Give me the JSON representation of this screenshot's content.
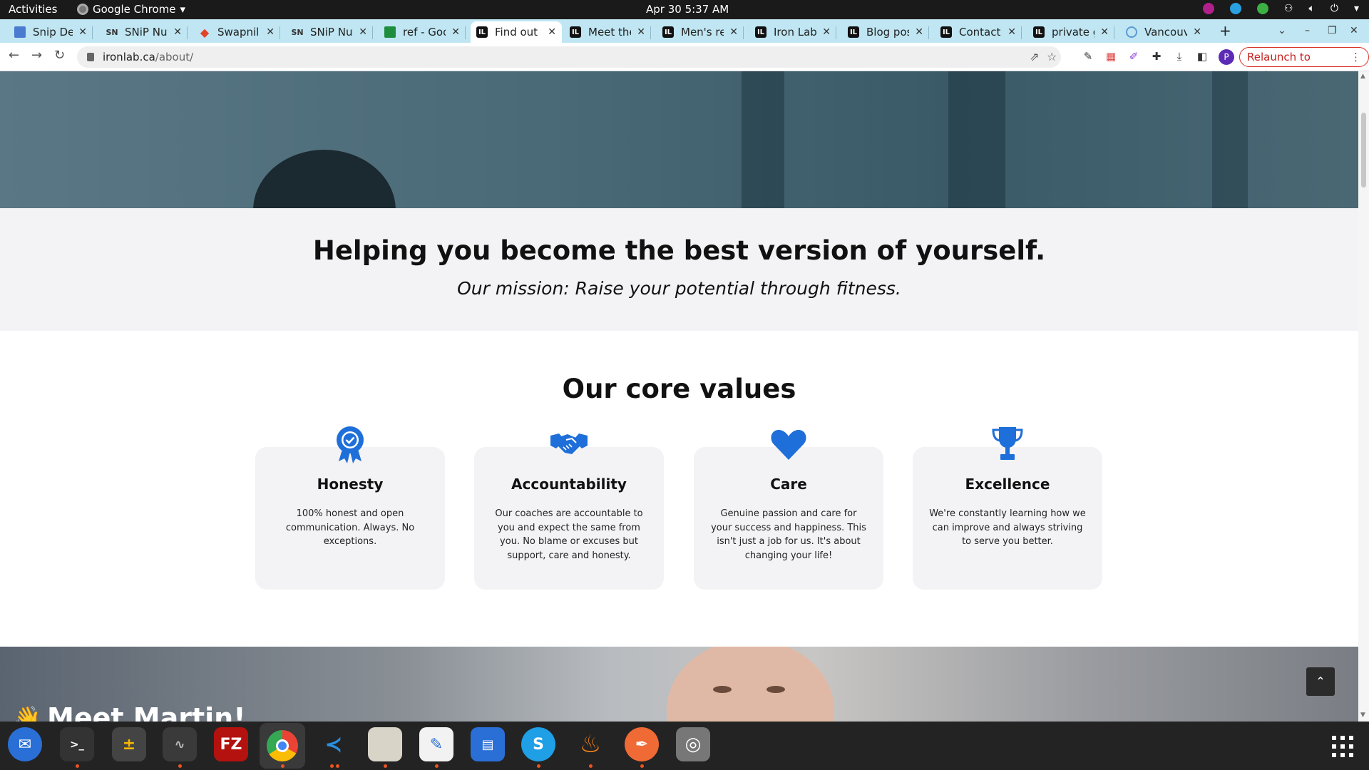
{
  "topbar": {
    "activities": "Activities",
    "app_name": "Google Chrome",
    "clock": "Apr 30  5:37 AM"
  },
  "tabs": [
    {
      "title": "Snip Deta",
      "icon": "doc-icon"
    },
    {
      "title": "SNiP Nutr",
      "icon": "snip-icon"
    },
    {
      "title": "Swapnil L",
      "icon": "gitlab-icon"
    },
    {
      "title": "SNiP Nutr",
      "icon": "snip-icon"
    },
    {
      "title": "ref - Goog",
      "icon": "sheets-icon"
    },
    {
      "title": "Find out m",
      "icon": "ironlab-icon",
      "active": true
    },
    {
      "title": "Meet the",
      "icon": "ironlab-icon"
    },
    {
      "title": "Men's res",
      "icon": "ironlab-icon"
    },
    {
      "title": "Iron Lab p",
      "icon": "ironlab-icon"
    },
    {
      "title": "Blog post",
      "icon": "ironlab-icon"
    },
    {
      "title": "Contact u",
      "icon": "ironlab-icon"
    },
    {
      "title": "private gy",
      "icon": "ironlab-icon"
    },
    {
      "title": "Vancouve",
      "icon": "globe-icon"
    }
  ],
  "toolbar": {
    "url_host": "ironlab.ca",
    "url_path": "/about/",
    "relaunch_label": "Relaunch to update",
    "profile_initial": "P"
  },
  "page": {
    "mission_heading": "Helping you become the best version of yourself.",
    "mission_sub": "Our mission: Raise your potential through fitness.",
    "values_title": "Our core values",
    "values": [
      {
        "title": "Honesty",
        "text": "100% honest and open communication. Always. No exceptions.",
        "icon": "award-ribbon-icon"
      },
      {
        "title": "Accountability",
        "text": "Our coaches are accountable to you and expect the same from you. No blame or excuses but support, care and honesty.",
        "icon": "handshake-icon"
      },
      {
        "title": "Care",
        "text": "Genuine passion and care for your success and happiness. This isn't just a job for us. It's about changing your life!",
        "icon": "heart-icon"
      },
      {
        "title": "Excellence",
        "text": "We're constantly learning how we can improve and always striving to serve you better.",
        "icon": "trophy-icon"
      }
    ],
    "meet_heading": "Meet Martin!"
  },
  "colors": {
    "accent_blue": "#1e6fd9",
    "tabstrip": "#bfe6f2",
    "card_bg": "#f3f3f5",
    "relaunch_red": "#c5221f"
  },
  "dock": [
    "thunderbird-icon",
    "terminal-icon",
    "calculator-icon",
    "system-monitor-icon",
    "filezilla-icon",
    "chrome-icon",
    "vscode-icon",
    "files-icon",
    "text-editor-icon",
    "document-viewer-icon",
    "skype-icon",
    "ember-icon",
    "pen-icon",
    "disk-icon"
  ]
}
